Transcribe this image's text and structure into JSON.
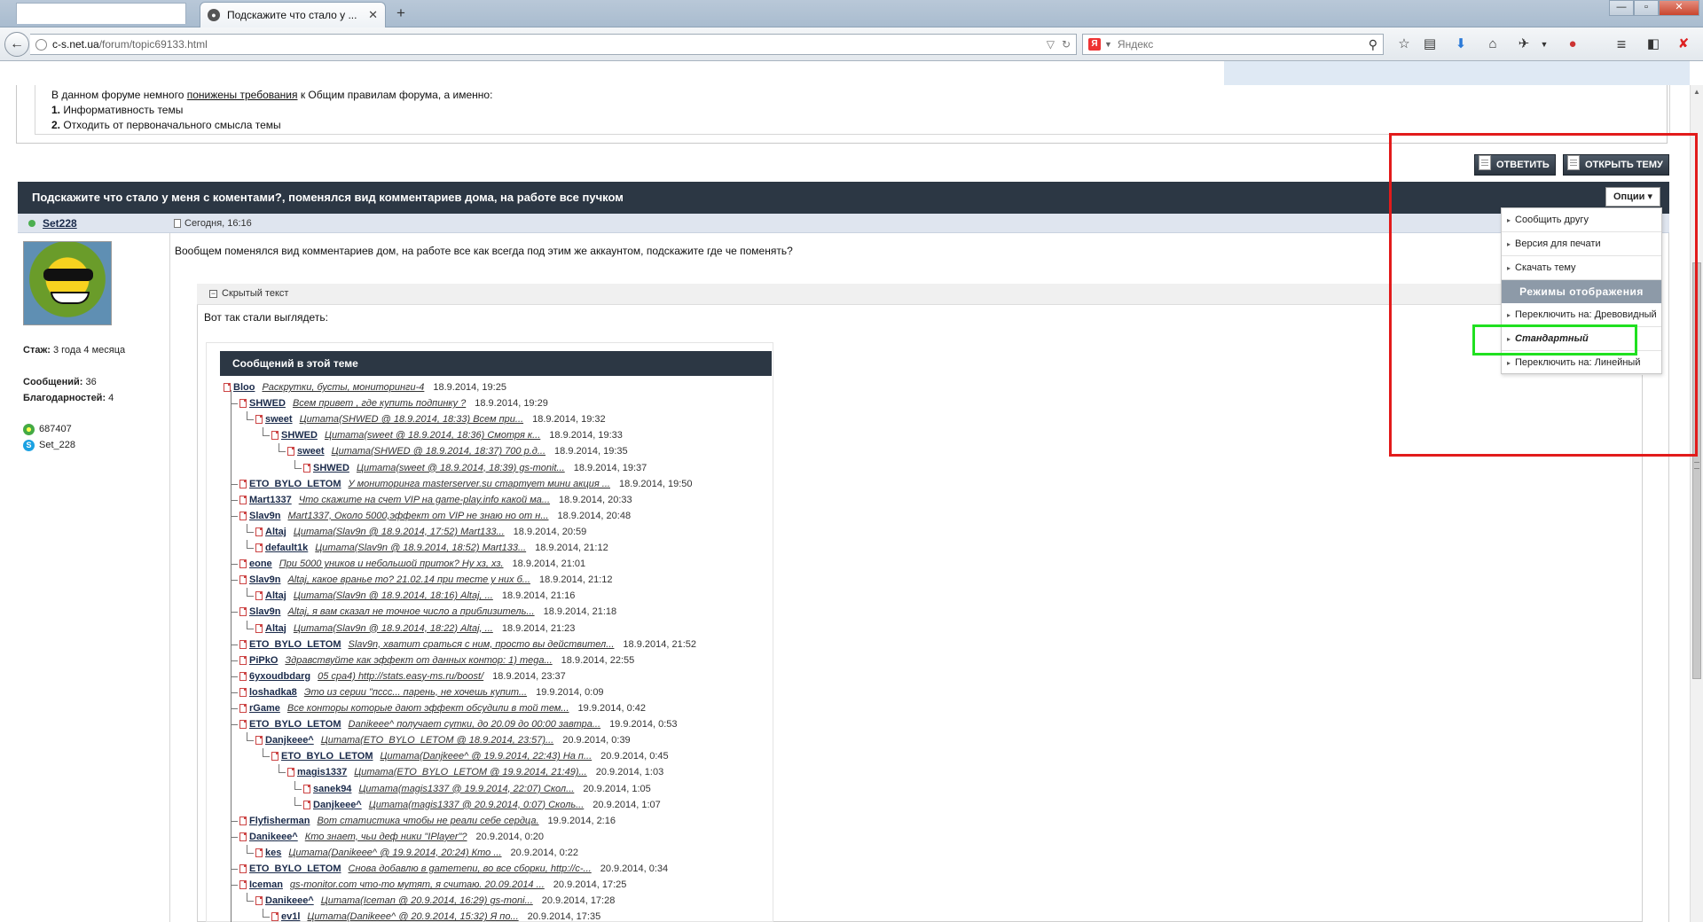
{
  "browser": {
    "tab_title": "Подскажите что стало у ...",
    "url_host": "c-s.net.ua",
    "url_path": "/forum/topic69133.html",
    "search_placeholder": "Яндекс",
    "search_engine_glyph": "Я"
  },
  "rules": {
    "intro_before": "В данном форуме немного ",
    "intro_link": "понижены требования",
    "intro_after": " к Общим правилам форума, а именно:",
    "item1_num": "1.",
    "item1": " Информативность темы",
    "item2_num": "2.",
    "item2": " Отходить от первоначального смысла темы"
  },
  "actions": {
    "reply": "ОТВЕТИТЬ",
    "new_topic": "ОТКРЫТЬ ТЕМУ"
  },
  "topic": {
    "title": "Подскажите что стало у меня с коментами?, поменялся вид комментариев дома, на работе все пучком",
    "options_label": "Опции"
  },
  "post": {
    "author": "Set228",
    "date": "Сегодня, 16:16",
    "text": "Вообщем поменялся вид комментариев дом, на работе все как всегда под этим же аккаунтом, подскажите где че поменять?",
    "spoiler_label": "Скрытый текст",
    "spoiler_text": "Вот так стали выглядеть:"
  },
  "user": {
    "tenure_label": "Стаж:",
    "tenure": " 3 года 4 месяца",
    "posts_label": "Сообщений:",
    "posts": " 36",
    "thanks_label": "Благодарностей:",
    "thanks": " 4",
    "icq": "687407",
    "skype": "Set_228"
  },
  "thread_screenshot": {
    "title": "Сообщений в этой теме",
    "rows": [
      {
        "depth": 0,
        "name": "Bloo",
        "text": "Раскрутки, бусты, мониторинги-4",
        "date": "18.9.2014, 19:25"
      },
      {
        "depth": 1,
        "name": "SHWED",
        "text": "Всем привет , где купить подпинку ?",
        "date": "18.9.2014, 19:29"
      },
      {
        "depth": 2,
        "name": "sweet",
        "text": "Цитата(SHWED @ 18.9.2014, 18:33) Всем при...",
        "date": "18.9.2014, 19:32"
      },
      {
        "depth": 3,
        "name": "SHWED",
        "text": "Цитата(sweet @ 18.9.2014, 18:36) Смотря к...",
        "date": "18.9.2014, 19:33"
      },
      {
        "depth": 4,
        "name": "sweet",
        "text": "Цитата(SHWED @ 18.9.2014, 18:37) 700 р.д...",
        "date": "18.9.2014, 19:35"
      },
      {
        "depth": 5,
        "name": "SHWED",
        "text": "Цитата(sweet @ 18.9.2014, 18:39) gs-monit...",
        "date": "18.9.2014, 19:37"
      },
      {
        "depth": 1,
        "name": "ETO_BYLO_LETOM",
        "text": "У мониторинга masterserver.su стартует мини акция ...",
        "date": "18.9.2014, 19:50"
      },
      {
        "depth": 1,
        "name": "Mart1337",
        "text": "Что скажите на счет VIP на game-play.info какой ма...",
        "date": "18.9.2014, 20:33"
      },
      {
        "depth": 1,
        "name": "Slav9n",
        "text": "Mart1337, Около 5000,эффект от VIP не знаю но от н...",
        "date": "18.9.2014, 20:48"
      },
      {
        "depth": 2,
        "name": "Altaj",
        "text": "Цитата(Slav9n @ 18.9.2014, 17:52) Mart133...",
        "date": "18.9.2014, 20:59"
      },
      {
        "depth": 2,
        "name": "default1k",
        "text": "Цитата(Slav9n @ 18.9.2014, 18:52) Mart133...",
        "date": "18.9.2014, 21:12"
      },
      {
        "depth": 1,
        "name": "eone",
        "text": "При 5000 уников и небольшой приток? Ну хз, хз.",
        "date": "18.9.2014, 21:01"
      },
      {
        "depth": 1,
        "name": "Slav9n",
        "text": "Altaj, какое вранье то? 21.02.14 при тесте у них б...",
        "date": "18.9.2014, 21:12"
      },
      {
        "depth": 2,
        "name": "Altaj",
        "text": "Цитата(Slav9n @ 18.9.2014, 18:16) Altaj, ...",
        "date": "18.9.2014, 21:16"
      },
      {
        "depth": 1,
        "name": "Slav9n",
        "text": "Altaj, я вам сказал не точное число а приблизитель...",
        "date": "18.9.2014, 21:18"
      },
      {
        "depth": 2,
        "name": "Altaj",
        "text": "Цитата(Slav9n @ 18.9.2014, 18:22) Altaj, ...",
        "date": "18.9.2014, 21:23"
      },
      {
        "depth": 1,
        "name": "ETO_BYLO_LETOM",
        "text": "Slav9n, хватит сраться с ним, просто вы действител...",
        "date": "18.9.2014, 21:52"
      },
      {
        "depth": 1,
        "name": "PiPkO",
        "text": "Здравствуйте как эффект от данных контор: 1) mega...",
        "date": "18.9.2014, 22:55"
      },
      {
        "depth": 1,
        "name": "6yxoudbdarg",
        "text": "05 cpa4) http://stats.easy-ms.ru/boost/",
        "date": "18.9.2014, 23:37"
      },
      {
        "depth": 1,
        "name": "loshadka8",
        "text": "Это из серии \"пссс... парень, не хочешь купит...",
        "date": "19.9.2014, 0:09"
      },
      {
        "depth": 1,
        "name": "rGame",
        "text": "Все конторы которые дают эффект обсудили в той тем...",
        "date": "19.9.2014, 0:42"
      },
      {
        "depth": 1,
        "name": "ETO_BYLO_LETOM",
        "text": "Danikeee^ получает сутки, до 20.09 до 00:00 завтра...",
        "date": "19.9.2014, 0:53"
      },
      {
        "depth": 2,
        "name": "Danjkeee^",
        "text": "Цитата(ETO_BYLO_LETOM @ 18.9.2014, 23:57)...",
        "date": "20.9.2014, 0:39"
      },
      {
        "depth": 3,
        "name": "ETO_BYLO_LETOM",
        "text": "Цитата(Danjkeee^ @ 19.9.2014, 22:43) На п...",
        "date": "20.9.2014, 0:45"
      },
      {
        "depth": 4,
        "name": "magis1337",
        "text": "Цитата(ETO_BYLO_LETOM @ 19.9.2014, 21:49)...",
        "date": "20.9.2014, 1:03"
      },
      {
        "depth": 5,
        "name": "sanek94",
        "text": "Цитата(magis1337 @ 19.9.2014, 22:07) Скол...",
        "date": "20.9.2014, 1:05"
      },
      {
        "depth": 5,
        "name": "Danjkeee^",
        "text": "Цитата(magis1337 @ 20.9.2014, 0:07) Сколь...",
        "date": "20.9.2014, 1:07"
      },
      {
        "depth": 1,
        "name": "Flyfisherman",
        "text": "Вот статистика чтобы не реали себе сердца.",
        "date": "19.9.2014, 2:16"
      },
      {
        "depth": 1,
        "name": "Danikeee^",
        "text": "Кто знает, чьи деф ники \"IPlayer\"?",
        "date": "20.9.2014, 0:20"
      },
      {
        "depth": 2,
        "name": "kes",
        "text": "Цитата(Danikeee^ @ 19.9.2014, 20:24) Кто ...",
        "date": "20.9.2014, 0:22"
      },
      {
        "depth": 1,
        "name": "ETO_BYLO_LETOM",
        "text": "Снова добавлю в gamemenu, во все сборки, http://c-...",
        "date": "20.9.2014, 0:34"
      },
      {
        "depth": 1,
        "name": "Iceman",
        "text": "gs-monitor.com что-то мутят, я считаю. 20.09.2014 ...",
        "date": "20.9.2014, 17:25"
      },
      {
        "depth": 2,
        "name": "Danikeee^",
        "text": "Цитата(Iceman @ 20.9.2014, 16:29) gs-moni...",
        "date": "20.9.2014, 17:28"
      },
      {
        "depth": 3,
        "name": "ev1l",
        "text": "Цитата(Danikeee^ @ 20.9.2014, 15:32) Я по...",
        "date": "20.9.2014, 17:35"
      }
    ]
  },
  "options_menu": {
    "items_top": [
      "Сообщить другу",
      "Версия для печати",
      "Скачать тему"
    ],
    "section_title": "Режимы отображения",
    "items_bottom": [
      "Переключить на: Древовидный",
      "Стандартный",
      "Переключить на: Линейный"
    ]
  },
  "colors": {
    "header_bar": "#2c3744",
    "annotation_red": "#e21b1b",
    "annotation_green": "#20e020"
  }
}
